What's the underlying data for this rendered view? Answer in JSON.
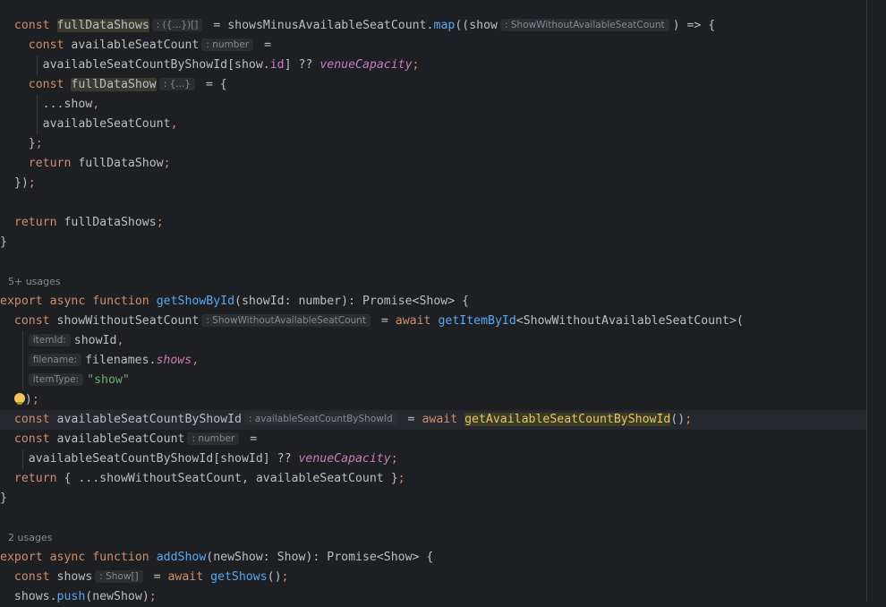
{
  "code": {
    "l1": {
      "kw": "const",
      "var": "fullDataShows",
      "hint": ": ({...})[]",
      "eq": " = ",
      "obj": "showsMinusAvailableSeatCount",
      "dot": ".",
      "fn": "map",
      "open": "((show",
      "hint2": ": ShowWithoutAvailableSeatCount",
      "close": ") => {"
    },
    "l2": {
      "kw": "const",
      "var": "availableSeatCount",
      "hint": ": number",
      "eq": " ="
    },
    "l3": {
      "a": "availableSeatCountByShowId[show.",
      "prop": "id",
      "b": "] ?? ",
      "c": "venueCapacity",
      ";": ";"
    },
    "l4": {
      "kw": "const",
      "var": "fullDataShow",
      "hint": ": {...}",
      "rest": " = {"
    },
    "l5": {
      "a": "...show",
      "b": ","
    },
    "l6": {
      "a": "availableSeatCount",
      "b": ","
    },
    "l7": {
      "a": "}",
      "b": ";"
    },
    "l8": {
      "kw": "return",
      "a": " fullDataShow",
      "b": ";"
    },
    "l9": {
      "a": "})",
      "b": ";"
    },
    "l10": {
      "kw": "return",
      "a": " fullDataShows",
      "b": ";"
    },
    "l11": {
      "a": "}"
    },
    "usages1": "5+ usages",
    "l12": {
      "kw1": "export",
      "kw2": " async",
      "kw3": " function",
      "fn": " getShowById",
      "a": "(showId: number): Promise<Show> {"
    },
    "l13": {
      "kw": "const",
      "var": " showWithoutSeatCount",
      "hint": ": ShowWithoutAvailableSeatCount",
      "eq": " = ",
      "kw2": "await",
      "fn": " getItemById",
      "rest": "<ShowWithoutAvailableSeatCount>("
    },
    "l14": {
      "hint": "itemId:",
      "a": "showId",
      "b": ","
    },
    "l15": {
      "hint": "filename:",
      "a": "filenames.",
      "prop": "shows",
      "b": ","
    },
    "l16": {
      "hint": "itemType:",
      "str": "\"show\""
    },
    "l17": {
      "a": ")",
      "b": ";"
    },
    "l18": {
      "kw": "const",
      "var": " availableSeatCountByShowId",
      "hint": ": availableSeatCountByShowId",
      "eq": " = ",
      "kw2": "await",
      "fn": "getAvailableSeatCountByShowId",
      "rest": "()",
      "semi": ";"
    },
    "l19": {
      "kw": "const",
      "var": " availableSeatCount",
      "hint": ": number",
      "eq": " ="
    },
    "l20": {
      "a": "availableSeatCountByShowId[showId] ?? ",
      "c": "venueCapacity",
      "b": ";"
    },
    "l21": {
      "kw": "return",
      "a": " { ...showWithoutSeatCount, availableSeatCount }",
      "b": ";"
    },
    "l22": {
      "a": "}"
    },
    "usages2": "2 usages",
    "l23": {
      "kw1": "export",
      "kw2": " async",
      "kw3": " function",
      "fn": " addShow",
      "a": "(newShow: Show): Promise<Show> {"
    },
    "l24": {
      "kw": "const",
      "var": " shows",
      "hint": ": Show[]",
      "eq": " = ",
      "kw2": "await",
      "fn": " getShows",
      "rest": "()",
      "semi": ";"
    },
    "l25": {
      "a": "shows.",
      "fn": "push",
      "rest": "(newShow)",
      "semi": ";"
    }
  }
}
